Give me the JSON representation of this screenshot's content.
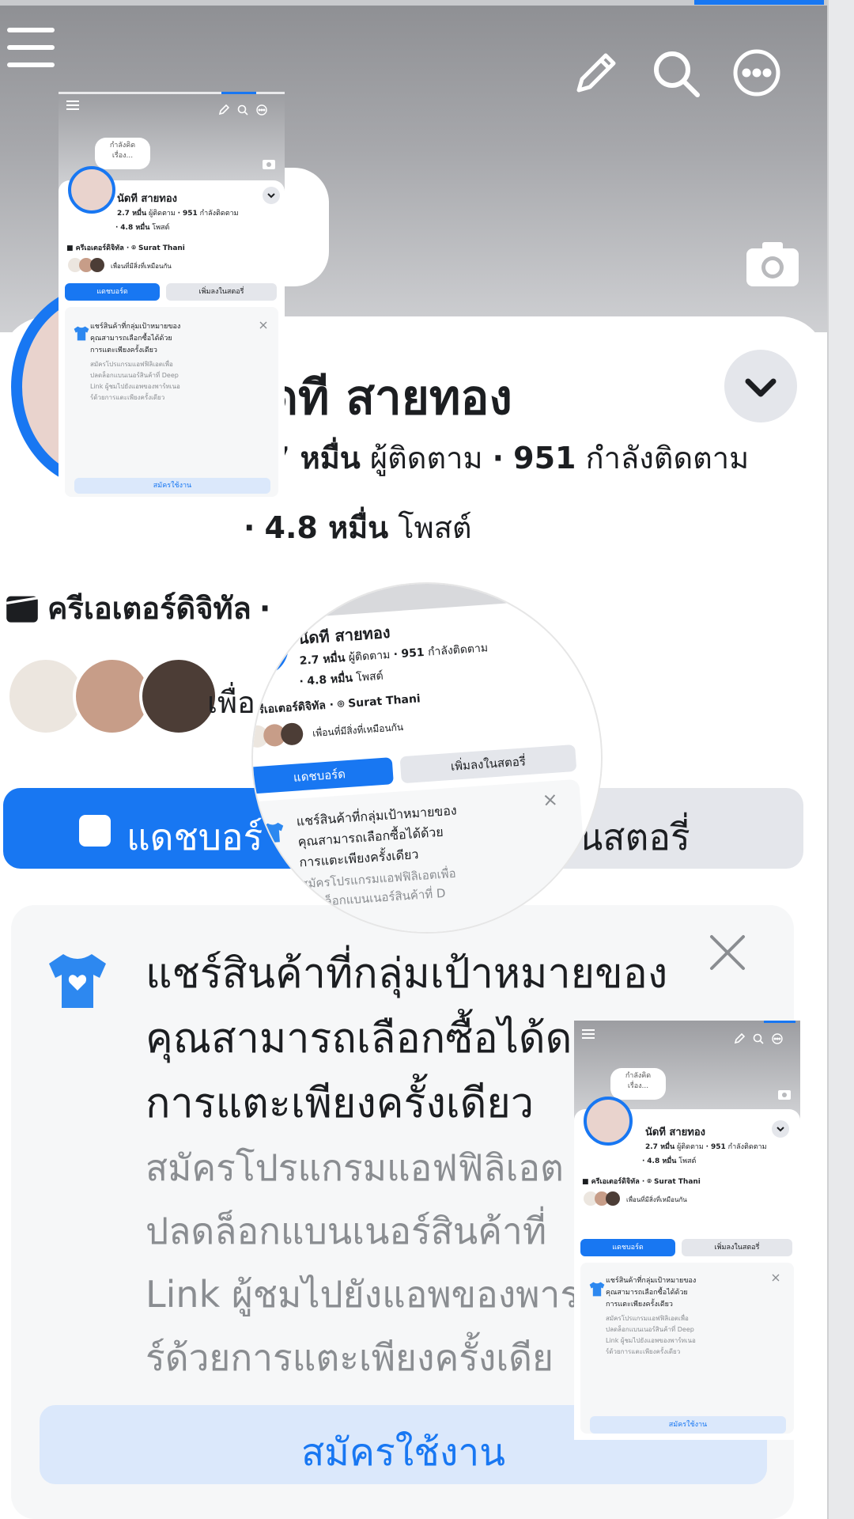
{
  "colors": {
    "accent": "#1877f2",
    "cover": "#a7a8ac",
    "light_button": "#e4e6eb",
    "apply_bg": "#dbe8fb",
    "muted": "#8a8d91"
  },
  "icons": [
    "menu-icon",
    "pencil-icon",
    "search-icon",
    "more-icon",
    "camera-icon",
    "chevron-down-icon",
    "clapperboard-icon",
    "location-pin-icon",
    "dashboard-icon",
    "add-story-icon",
    "tshirt-icon",
    "close-icon"
  ],
  "profile": {
    "name": "นัดที สายทอง",
    "name_partial": "ดที สายทอง",
    "followers_num": "2.7 หมื่น",
    "followers_num_partial": "7 หมื่น",
    "followers_label": "ผู้ติดตาม",
    "following_num": "951",
    "following_label": "กำลังติดตาม",
    "dot": "·",
    "posts_num": "4.8 หมื่น",
    "posts_label": "โพสต์",
    "category": "ครีเอเตอร์ดิจิทัล",
    "location": "Surat Thani",
    "location_partial": "i",
    "mutual": "เพื่อนที่มีสิ่งที่เหมือนกัน",
    "mutual_partial": "เพื่อ",
    "thought_line1": "กำลังคิด",
    "thought_line2": "เรื่อง..."
  },
  "actions": {
    "dashboard": "แดชบอร์ด",
    "dashboard_partial": "แดชบอร์",
    "add_story": "เพิ่มลงในสตอรี่",
    "add_story_partial": "งในสตอรี่"
  },
  "promo": {
    "title": "แชร์สินค้าที่กลุ่มเป้าหมายของคุณสามารถเลือกซื้อได้ด้วยการแตะเพียงครั้งเดียว",
    "title_l1": "แชร์สินค้าที่กลุ่มเป้าหมายของ",
    "title_l2": "คุณสามารถเลือกซื้อได้ด้วย",
    "title_l3": "การแตะเพียงครั้งเดียว",
    "desc_l1": "สมัครโปรแกรมแอฟฟิลิเอตเพื่อ",
    "desc_l2": "ปลดล็อกแบนเนอร์สินค้าที่ Deep",
    "desc_l3": "Link ผู้ชมไปยังแอพของพาร์ทเนอ",
    "desc_l4": "ร์ด้วยการแตะเพียงครั้งเดียว",
    "big_desc_l1": "สมัครโปรแกรมแอฟฟิลิเอต",
    "big_desc_l2": "ปลดล็อกแบนเนอร์สินค้าที่",
    "big_desc_l3": "Link ผู้ชมไปยังแอพของพาร",
    "big_desc_l4": "ร์ด้วยการแตะเพียงครั้งเดีย",
    "big_title_l2": "คุณสามารถเลือกซื้อได้ด",
    "lens_desc_l2": "ปลดล็อกแบนเนอร์สินค้าที่ D",
    "apply": "สมัครใช้งาน"
  }
}
